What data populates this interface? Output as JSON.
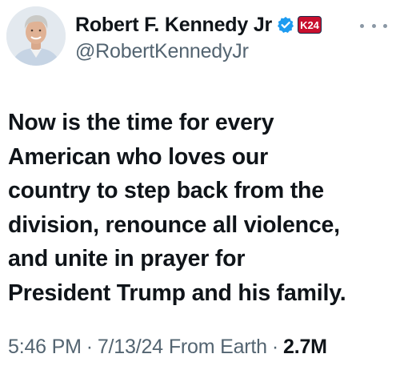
{
  "author": {
    "display_name": "Robert F. Kennedy Jr",
    "handle": "@RobertKennedyJr",
    "avatar_icon": "profile-photo",
    "verified_icon": "verified-badge-icon",
    "affiliate_badge_text": "K24",
    "colors": {
      "verified": "#1d9bf0",
      "affiliate_badge": "#c8102e"
    }
  },
  "tweet": {
    "text_lines": [
      "Now is the time for every",
      "American who loves our",
      "country to step back from the",
      "division, renounce all violence,",
      "and unite in prayer for",
      "President Trump and his family."
    ]
  },
  "meta": {
    "time": "5:46 PM",
    "separator": "·",
    "date": "7/13/24",
    "location": "From Earth",
    "views": "2.7M"
  },
  "more_icon": "more-options-icon"
}
